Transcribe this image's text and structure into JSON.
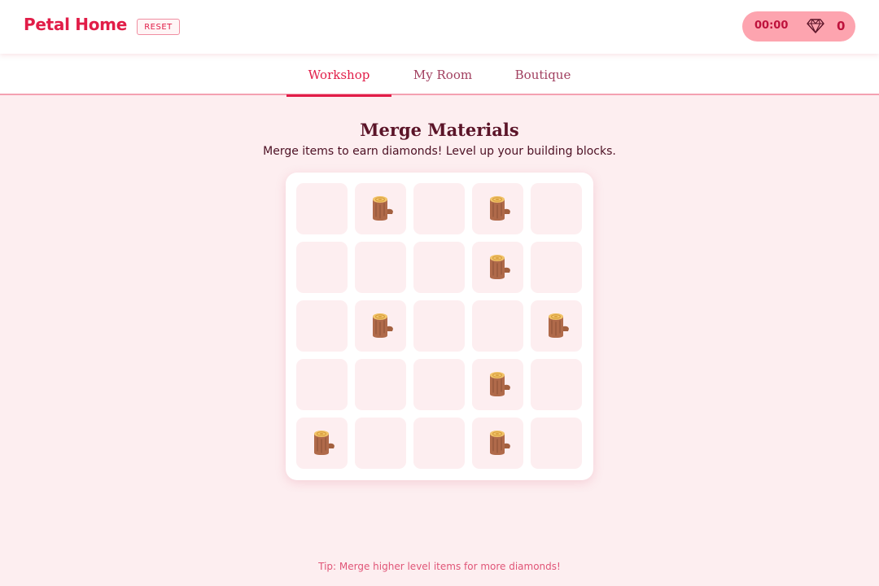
{
  "header": {
    "brand": "Petal Home",
    "reset_label": "RESET",
    "timer": "00:00",
    "diamond_icon": "diamond-icon",
    "diamonds": "0"
  },
  "tabs": [
    {
      "label": "Workshop",
      "active": true
    },
    {
      "label": "My Room",
      "active": false
    },
    {
      "label": "Boutique",
      "active": false
    }
  ],
  "main": {
    "title": "Merge Materials",
    "subtitle": "Merge items to earn diamonds! Level up your building blocks."
  },
  "board": {
    "rows": 5,
    "cols": 5,
    "item_icon": "wood-log-icon",
    "cells": [
      [
        null,
        "log",
        null,
        "log",
        null
      ],
      [
        null,
        null,
        null,
        "log",
        null
      ],
      [
        null,
        "log",
        null,
        null,
        "log"
      ],
      [
        null,
        null,
        null,
        "log",
        null
      ],
      [
        "log",
        null,
        null,
        "log",
        null
      ]
    ]
  },
  "tip": "Tip: Merge higher level items for more diamonds!",
  "colors": {
    "accent": "#e11d48",
    "background": "#fdeef0",
    "badge": "#fda4af"
  }
}
